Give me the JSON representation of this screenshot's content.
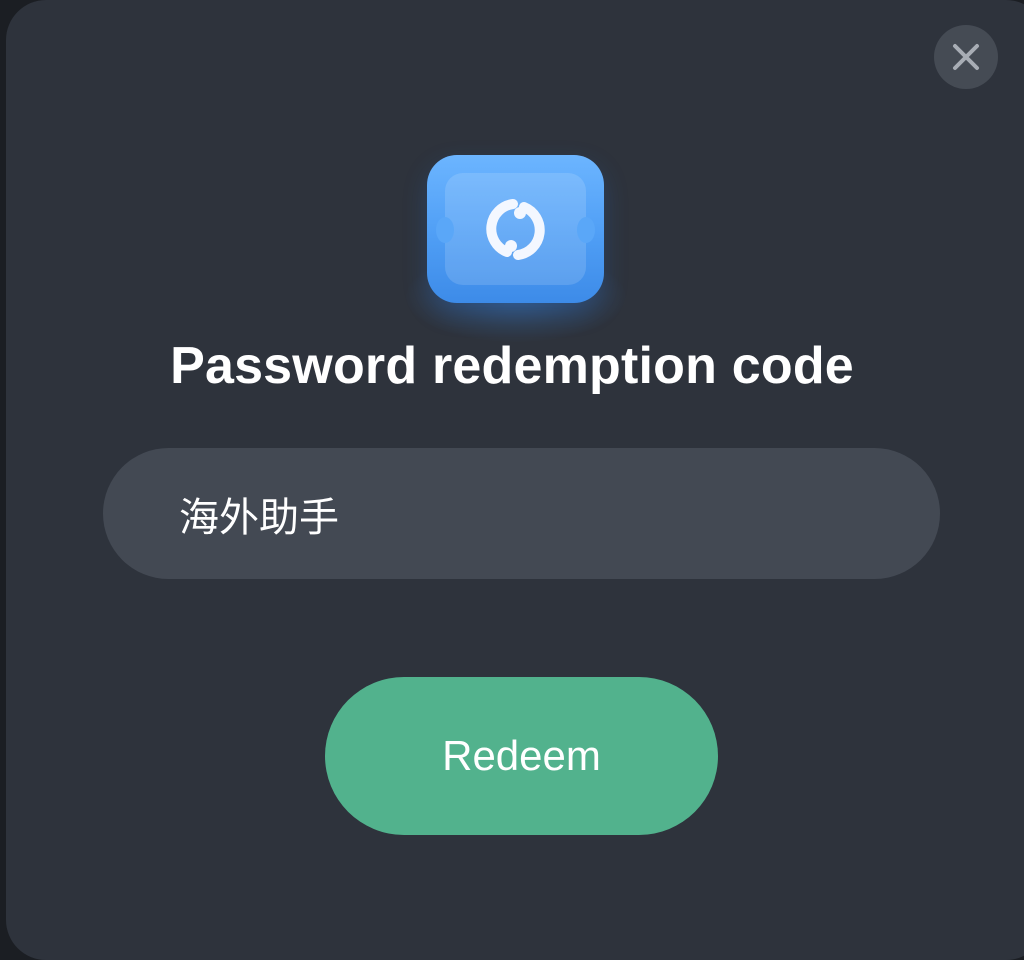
{
  "dialog": {
    "title": "Password redemption code",
    "close_icon": "close-icon",
    "hero_icon": "sync-ticket-icon"
  },
  "code_field": {
    "value": "海外助手"
  },
  "actions": {
    "redeem_label": "Redeem"
  },
  "colors": {
    "dialog_background": "#2e333c",
    "input_background": "#434953",
    "accent_green": "#52b28d",
    "icon_blue": "#4f9ef5",
    "close_button_background": "#454b54"
  }
}
